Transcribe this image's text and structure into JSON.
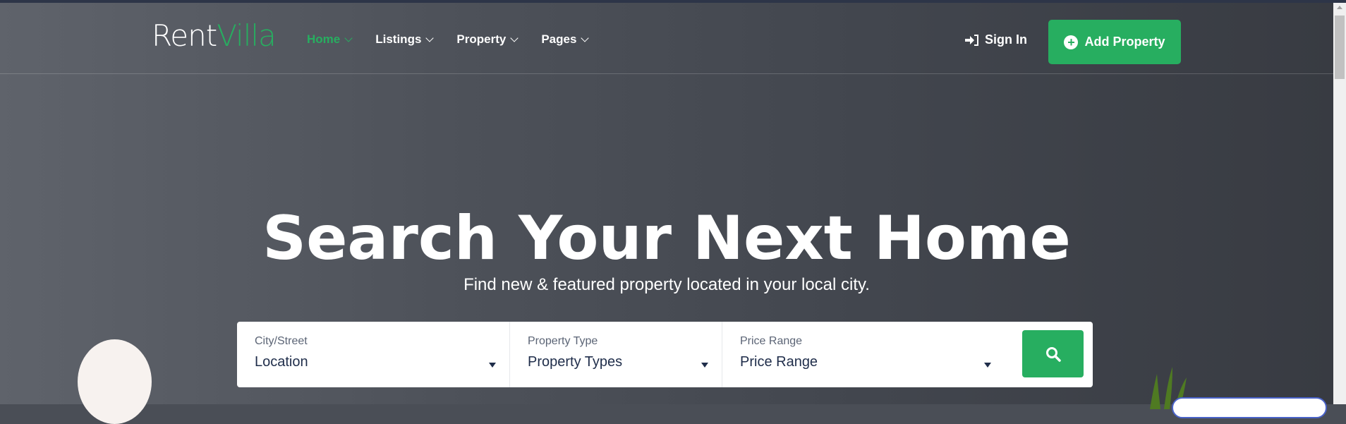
{
  "logo": {
    "part1": "Rent",
    "part2": "Villa"
  },
  "nav": [
    {
      "label": "Home"
    },
    {
      "label": "Listings"
    },
    {
      "label": "Property"
    },
    {
      "label": "Pages"
    }
  ],
  "header": {
    "sign_in": "Sign In",
    "add_property": "Add Property"
  },
  "hero": {
    "title": "Search Your Next Home",
    "subtitle": "Find new & featured property located in your local city."
  },
  "search": {
    "fields": [
      {
        "label": "City/Street",
        "value": "Location"
      },
      {
        "label": "Property Type",
        "value": "Property Types"
      },
      {
        "label": "Price Range",
        "value": "Price Range"
      }
    ]
  },
  "colors": {
    "accent": "#27ae60",
    "text_dark": "#1f2d4a"
  }
}
